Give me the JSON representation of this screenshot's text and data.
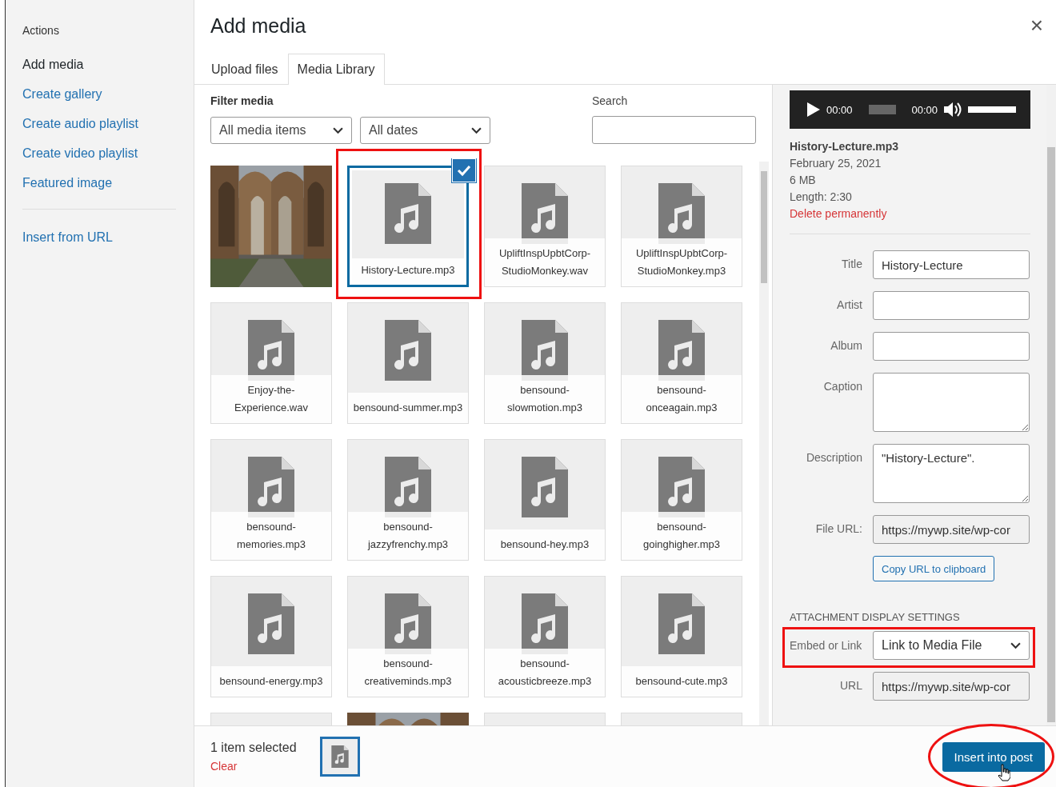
{
  "sidebar": {
    "heading": "Actions",
    "items": [
      {
        "label": "Add media",
        "selected": true
      },
      {
        "label": "Create gallery",
        "selected": false
      },
      {
        "label": "Create audio playlist",
        "selected": false
      },
      {
        "label": "Create video playlist",
        "selected": false
      },
      {
        "label": "Featured image",
        "selected": false
      }
    ],
    "extra_items": [
      {
        "label": "Insert from URL",
        "selected": false
      }
    ]
  },
  "header": {
    "title": "Add media",
    "close": "×"
  },
  "tabs": [
    {
      "label": "Upload files",
      "selected": false
    },
    {
      "label": "Media Library",
      "selected": true
    }
  ],
  "filter": {
    "label": "Filter media",
    "type_select": "All media items",
    "date_select": "All dates",
    "search_label": "Search"
  },
  "items": [
    {
      "kind": "picture",
      "selected": false
    },
    {
      "kind": "audio",
      "name": "History-Lecture.mp3",
      "selected": true
    },
    {
      "kind": "audio",
      "name": "UpliftInspUpbtCorp-StudioMonkey.wav",
      "selected": false
    },
    {
      "kind": "audio",
      "name": "UpliftInspUpbtCorp-StudioMonkey.mp3",
      "selected": false
    },
    {
      "kind": "audio",
      "name": "Enjoy-the-Experience.wav",
      "selected": false
    },
    {
      "kind": "audio",
      "name": "bensound-summer.mp3",
      "selected": false
    },
    {
      "kind": "audio",
      "name": "bensound-slowmotion.mp3",
      "selected": false
    },
    {
      "kind": "audio",
      "name": "bensound-onceagain.mp3",
      "selected": false
    },
    {
      "kind": "audio",
      "name": "bensound-memories.mp3",
      "selected": false
    },
    {
      "kind": "audio",
      "name": "bensound-jazzyfrenchy.mp3",
      "selected": false
    },
    {
      "kind": "audio",
      "name": "bensound-hey.mp3",
      "selected": false
    },
    {
      "kind": "audio",
      "name": "bensound-goinghigher.mp3",
      "selected": false
    },
    {
      "kind": "audio",
      "name": "bensound-energy.mp3",
      "selected": false
    },
    {
      "kind": "audio",
      "name": "bensound-creativeminds.mp3",
      "selected": false
    },
    {
      "kind": "audio",
      "name": "bensound-acousticbreeze.mp3",
      "selected": false
    },
    {
      "kind": "audio",
      "name": "bensound-cute.mp3",
      "selected": false
    },
    {
      "kind": "audio",
      "selected": false
    },
    {
      "kind": "picture",
      "selected": false
    },
    {
      "kind": "audio",
      "selected": false
    },
    {
      "kind": "audio",
      "selected": false
    }
  ],
  "details": {
    "player": {
      "current": "00:00",
      "progress": {
        "level": 0
      },
      "duration": "00:00",
      "volume": {
        "level": 1
      }
    },
    "filename": "History-Lecture.mp3",
    "date": "February 25, 2021",
    "size": "6 MB",
    "length": "Length: 2:30",
    "delete": "Delete permanently",
    "fields": [
      {
        "label": "Title",
        "kind": "input",
        "value": "History-Lecture"
      },
      {
        "label": "Artist",
        "kind": "input"
      },
      {
        "label": "Album",
        "kind": "input"
      },
      {
        "label": "Caption",
        "kind": "textarea"
      },
      {
        "label": "Description",
        "kind": "textarea",
        "value": "\"History-Lecture\"."
      },
      {
        "label": "File URL:",
        "kind": "readonly",
        "value": "https://mywp.site/wp-cor"
      }
    ],
    "copy_button": "Copy URL to clipboard",
    "settings_heading": "ATTACHMENT DISPLAY SETTINGS",
    "embed": {
      "label": "Embed or Link",
      "value": "Link to Media File"
    },
    "url": {
      "label": "URL",
      "value": "https://mywp.site/wp-cor"
    }
  },
  "toolbar": {
    "selection": "1 item selected",
    "clear": "Clear",
    "insert_button": "Insert into post"
  }
}
